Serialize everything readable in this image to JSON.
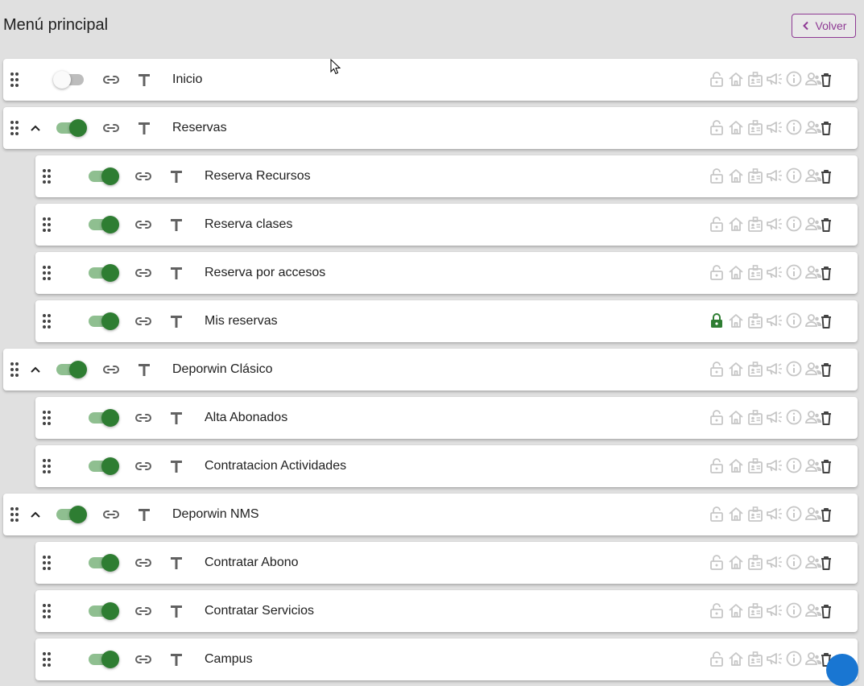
{
  "header": {
    "title": "Menú principal",
    "back_label": "Volver"
  },
  "colors": {
    "background": "#e0e0e0",
    "accent_green": "#2e7d32",
    "toggle_track_on": "#8fbf90",
    "icon_muted": "#c6c6c6",
    "icon_dark": "#616161",
    "back_button": "#8e3a94"
  },
  "icons": {
    "drag": "drag-handle-icon",
    "collapse": "chevron-up-icon",
    "link": "link-icon",
    "text": "text-format-icon",
    "lock": "lock-icon",
    "home": "home-icon",
    "badge": "id-badge-icon",
    "announce": "megaphone-icon",
    "info": "info-icon",
    "users": "users-icon",
    "delete": "trash-icon"
  },
  "menu_items": [
    {
      "label": "Inicio",
      "level": 0,
      "enabled": false,
      "expandable": false,
      "locked": false
    },
    {
      "label": "Reservas",
      "level": 0,
      "enabled": true,
      "expandable": true,
      "locked": false
    },
    {
      "label": "Reserva Recursos",
      "level": 1,
      "enabled": true,
      "expandable": false,
      "locked": false
    },
    {
      "label": "Reserva clases",
      "level": 1,
      "enabled": true,
      "expandable": false,
      "locked": false
    },
    {
      "label": "Reserva por accesos",
      "level": 1,
      "enabled": true,
      "expandable": false,
      "locked": false
    },
    {
      "label": "Mis reservas",
      "level": 1,
      "enabled": true,
      "expandable": false,
      "locked": true
    },
    {
      "label": "Deporwin Clásico",
      "level": 0,
      "enabled": true,
      "expandable": true,
      "locked": false
    },
    {
      "label": "Alta Abonados",
      "level": 1,
      "enabled": true,
      "expandable": false,
      "locked": false
    },
    {
      "label": "Contratacion Actividades",
      "level": 1,
      "enabled": true,
      "expandable": false,
      "locked": false
    },
    {
      "label": "Deporwin NMS",
      "level": 0,
      "enabled": true,
      "expandable": true,
      "locked": false
    },
    {
      "label": "Contratar Abono",
      "level": 1,
      "enabled": true,
      "expandable": false,
      "locked": false
    },
    {
      "label": "Contratar Servicios",
      "level": 1,
      "enabled": true,
      "expandable": false,
      "locked": false
    },
    {
      "label": "Campus",
      "level": 1,
      "enabled": true,
      "expandable": false,
      "locked": false
    }
  ]
}
